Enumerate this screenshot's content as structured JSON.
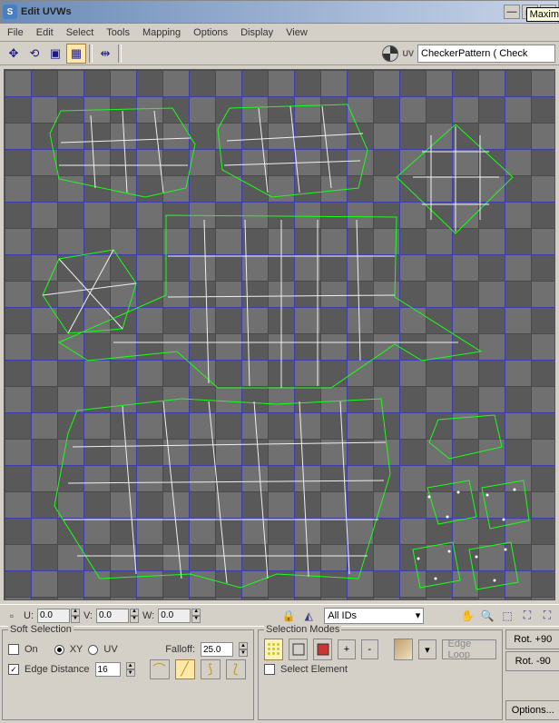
{
  "window": {
    "title": "Edit UVWs",
    "tooltip": "Maxim"
  },
  "menu": {
    "items": [
      "File",
      "Edit",
      "Select",
      "Tools",
      "Mapping",
      "Options",
      "Display",
      "View"
    ]
  },
  "toolbar": {
    "map_dropdown": "CheckerPattern  ( Check",
    "uv_glyph": "UV"
  },
  "uvw_inputs": {
    "u_label": "U:",
    "u_value": "0.0",
    "v_label": "V:",
    "v_value": "0.0",
    "w_label": "W:",
    "w_value": "0.0",
    "id_dropdown": "All IDs"
  },
  "soft_selection": {
    "legend": "Soft Selection",
    "on_label": "On",
    "xy_label": "XY",
    "uv_label": "UV",
    "falloff_label": "Falloff:",
    "falloff_value": "25.0",
    "edge_label": "Edge Distance",
    "edge_value": "16"
  },
  "selection_modes": {
    "legend": "Selection Modes",
    "plus": "+",
    "minus": "-",
    "edgeloop_label": "Edge Loop",
    "select_element_label": "Select Element"
  },
  "right_buttons": {
    "rot_p90": "Rot. +90",
    "rot_m90": "Rot. -90",
    "options": "Options..."
  }
}
